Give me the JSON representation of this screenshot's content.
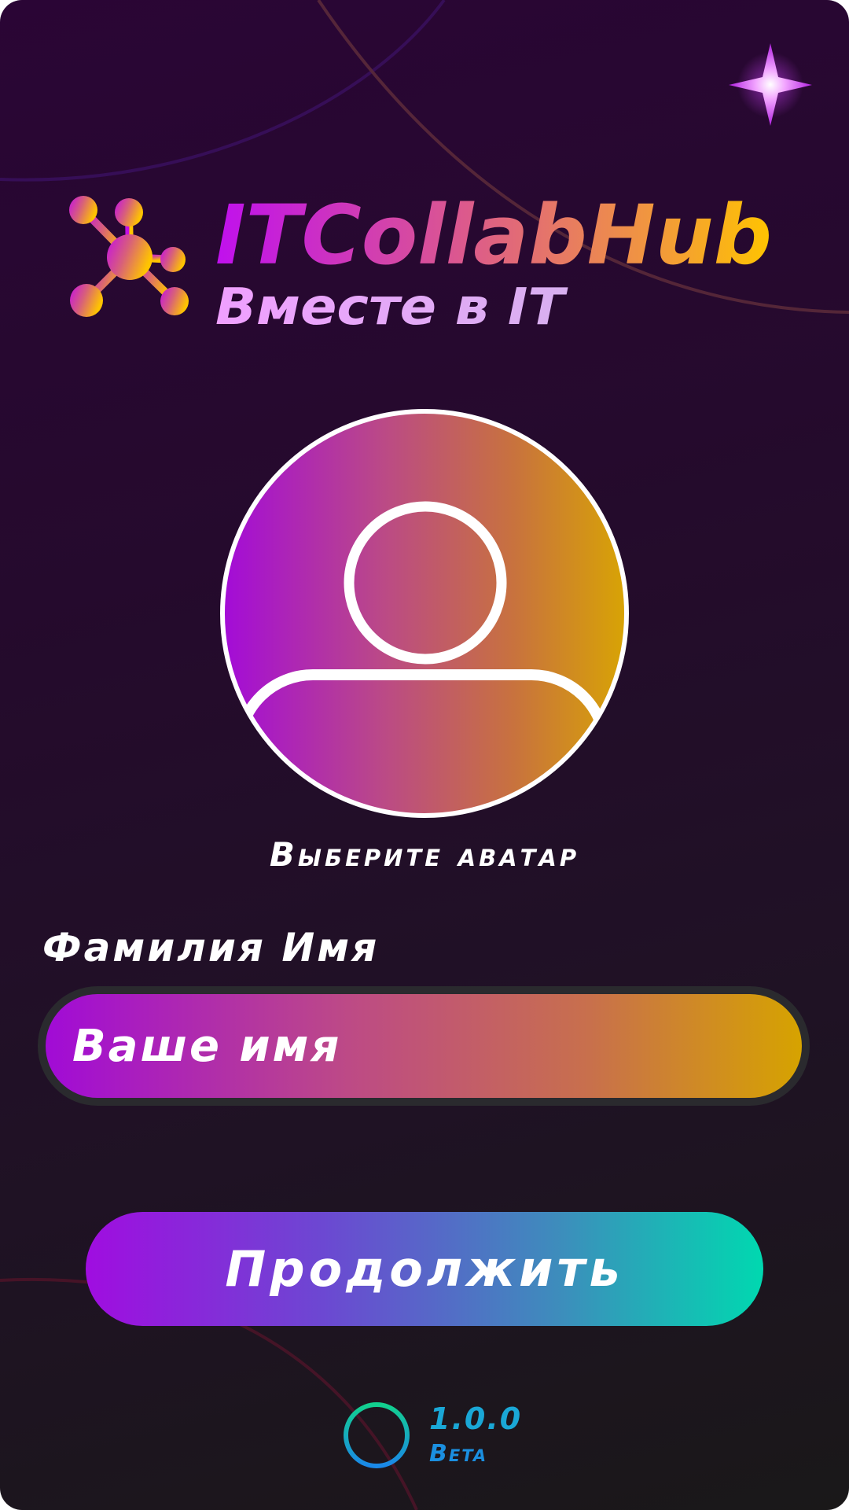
{
  "app": {
    "name": "ITCollabHub",
    "tagline": "Вместе в IT"
  },
  "avatar": {
    "caption": "Выберите аватар",
    "icon": "user-icon"
  },
  "form": {
    "name_label": "Фамилия Имя",
    "name_placeholder": "Ваше имя",
    "name_value": ""
  },
  "actions": {
    "continue_label": "Продолжить"
  },
  "footer": {
    "version": "1.0.0",
    "stage": "Beta"
  },
  "colors": {
    "background": "#2a0535",
    "brand_purple": "#c018e8",
    "brand_orange": "#f29a3a",
    "brand_yellow": "#ffc400",
    "tagline": "#e8a8f8",
    "button_start": "#a00de0",
    "button_end": "#00d8b0",
    "version": "#1aa7d6"
  },
  "icons": {
    "logo": "network-hub-icon",
    "sparkle": "sparkle-icon",
    "status": "ring-icon"
  }
}
